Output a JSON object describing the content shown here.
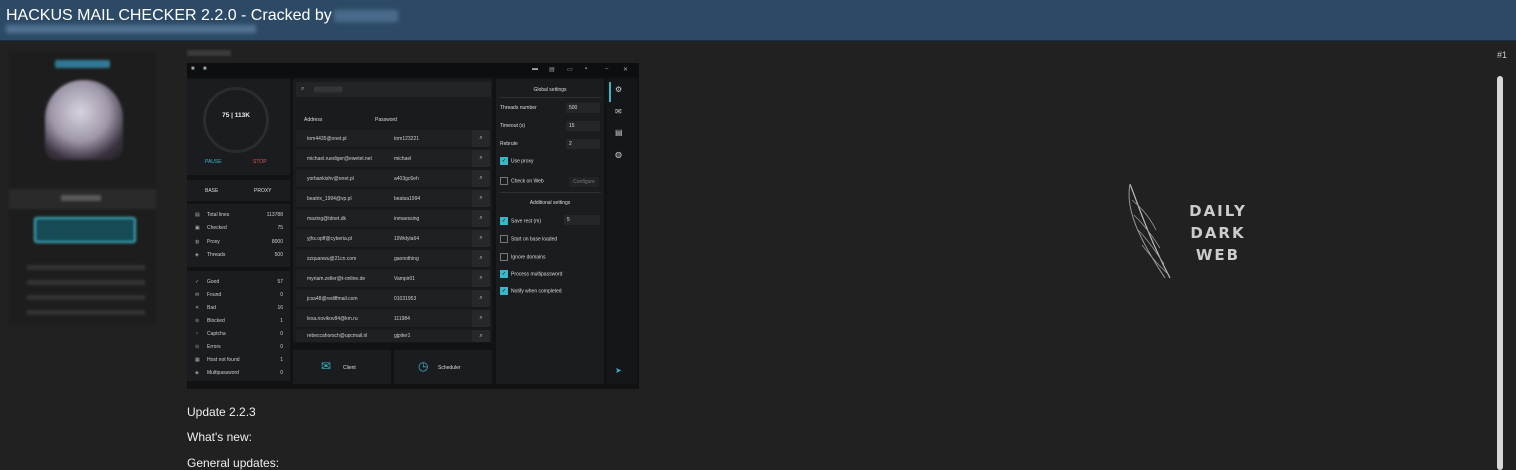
{
  "header": {
    "title": "HACKUS MAIL CHECKER 2.2.0 - Cracked by"
  },
  "post": {
    "number": "#1"
  },
  "app": {
    "progress_label": "75 | 113K",
    "pause_label": "PAUSE",
    "stop_label": "STOP",
    "tabs": [
      "BASE",
      "PROXY"
    ],
    "stats_top": [
      {
        "icon": "file-icon",
        "glyph": "▤",
        "label": "Total lines",
        "value": "113788"
      },
      {
        "icon": "check-icon",
        "glyph": "▣",
        "label": "Checked",
        "value": "75"
      },
      {
        "icon": "proxy-icon",
        "glyph": "◍",
        "label": "Proxy",
        "value": "8000"
      },
      {
        "icon": "threads-icon",
        "glyph": "◈",
        "label": "Threads",
        "value": "500"
      }
    ],
    "stats_bottom": [
      {
        "icon": "good-icon",
        "glyph": "✓",
        "label": "Good",
        "value": "57"
      },
      {
        "icon": "found-icon",
        "glyph": "✉",
        "label": "Found",
        "value": "0"
      },
      {
        "icon": "bad-icon",
        "glyph": "✕",
        "label": "Bad",
        "value": "16"
      },
      {
        "icon": "blocked-icon",
        "glyph": "⊝",
        "label": "Blocked",
        "value": "1"
      },
      {
        "icon": "captcha-icon",
        "glyph": "◔",
        "label": "Captcha",
        "value": "0"
      },
      {
        "icon": "errors-icon",
        "glyph": "⊙",
        "label": "Errors",
        "value": "0"
      },
      {
        "icon": "host-not-found-icon",
        "glyph": "▦",
        "label": "Host not found",
        "value": "1"
      },
      {
        "icon": "multipassword-icon",
        "glyph": "◈",
        "label": "Multipassword",
        "value": "0"
      }
    ],
    "table": {
      "headers": [
        "Address",
        "Password"
      ],
      "rows": [
        {
          "address": "tom4435@onet.pl",
          "password": "tom123221"
        },
        {
          "address": "michael.ruediger@ewetel.net",
          "password": "michael"
        },
        {
          "address": "yorbankishv@onet.pl",
          "password": "a403gc6eh"
        },
        {
          "address": "beatrix_1994@vp.pl",
          "password": "beatsa1994"
        },
        {
          "address": "mazing@tdnet.dk",
          "password": "inmaessing"
        },
        {
          "address": "yjhs.opff@cyberia.pl",
          "password": "19Wdyla64"
        },
        {
          "address": "szquanwu@21cn.com",
          "password": "gaonothing"
        },
        {
          "address": "myriam.zeller@t-online.de",
          "password": "Vampir01"
        },
        {
          "address": "jcsa48@rediffmail.com",
          "password": "01031953"
        },
        {
          "address": "lexa.novikov84@km.ru",
          "password": "111984"
        },
        {
          "address": "rebeccahorsch@upcmail.nl",
          "password": "gjpiter1"
        }
      ]
    },
    "bottom_buttons": [
      {
        "icon": "mail-icon",
        "glyph": "✉",
        "label": "Client"
      },
      {
        "icon": "clock-icon",
        "glyph": "◷",
        "label": "Scheduler"
      }
    ],
    "global_settings": {
      "title": "Global settings",
      "threads_label": "Threads number",
      "threads_value": "500",
      "timeout_label": "Timeout (s)",
      "timeout_value": "15",
      "rebrute_label": "Rebrute",
      "rebrute_value": "2",
      "use_proxy_label": "Use proxy",
      "check_on_web_label": "Check on Web",
      "configure_label": "Configure"
    },
    "additional_settings": {
      "title": "Additional settings",
      "save_rest_label": "Save rest (m)",
      "save_rest_value": "5",
      "start_on_base_label": "Start on base loaded",
      "ignore_domains_label": "Ignore domains",
      "process_multipassword_label": "Process multipassword",
      "notify_label": "Notify when completed"
    }
  },
  "watermark": {
    "lines": [
      "DAILY",
      "DARK",
      "WEB"
    ]
  },
  "body": {
    "update": "Update 2.2.3",
    "whats_new": "What's new:",
    "general_updates": "General updates:"
  },
  "colors": {
    "header_bg": "#2c4a66",
    "accent": "#3ab6c7",
    "stop": "#e05656"
  }
}
